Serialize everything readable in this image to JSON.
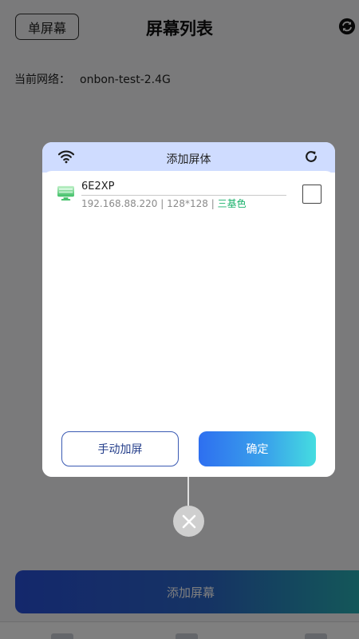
{
  "header": {
    "left_button": "单屏幕",
    "title": "屏幕列表",
    "sync_icon": "sync-icon"
  },
  "network": {
    "label": "当前网络：",
    "value": "onbon-test-2.4G"
  },
  "bottom": {
    "add_button": "添加屏幕"
  },
  "modal": {
    "title": "添加屏体",
    "wifi_icon": "wifi-icon",
    "refresh_icon": "refresh-icon",
    "devices": [
      {
        "name": "6E2XP",
        "ip": "192.168.88.220",
        "resolution": "128*128",
        "color_type": "三基色",
        "checked": false
      }
    ],
    "manual_button": "手动加屏",
    "confirm_button": "确定"
  },
  "colors": {
    "accent": "#2e6ff0",
    "accent_end": "#45dde0",
    "header_bg": "#cfdcff",
    "color_tag": "#1ab26b"
  }
}
